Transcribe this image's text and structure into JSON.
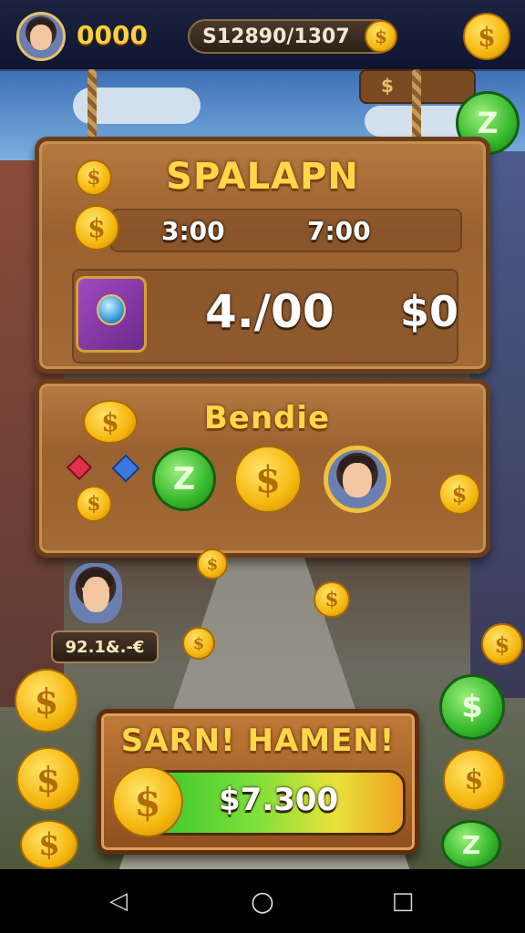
{
  "colors": {
    "gold": "#ffd84a",
    "wood": "#9a6130",
    "green": "#35b82c",
    "topbar": "#1c2440"
  },
  "topbar": {
    "player_coins": "0000",
    "balance": "S12890/1307",
    "balance_coin_symbol": "$",
    "shop_coin_symbol": "$"
  },
  "hanging_sign": {
    "symbol": "$"
  },
  "green_badge_top": {
    "symbol": "Z"
  },
  "panel1": {
    "title": "SPALAPN",
    "coin_symbol": "$",
    "time_left": "3:00",
    "time_right": "7:00",
    "amount": "4./00",
    "price": "$0"
  },
  "panel2": {
    "title": "Bendie",
    "reward_green_symbol": "Z",
    "reward_coin_symbol": "$",
    "stack_coin_symbol": "$",
    "side_coin_symbol": "$"
  },
  "player": {
    "value": "92.1&.-€"
  },
  "bottom_banner": {
    "title": "SARN! HAMEN!",
    "coin_symbol": "$",
    "progress_value": "$7.300",
    "progress_fraction": 1.0
  },
  "navbar": {
    "back_icon": "◁",
    "home_icon": "○",
    "recent_icon": "□"
  },
  "decor_coin_symbol": "$",
  "decor_green_symbol": "Z"
}
